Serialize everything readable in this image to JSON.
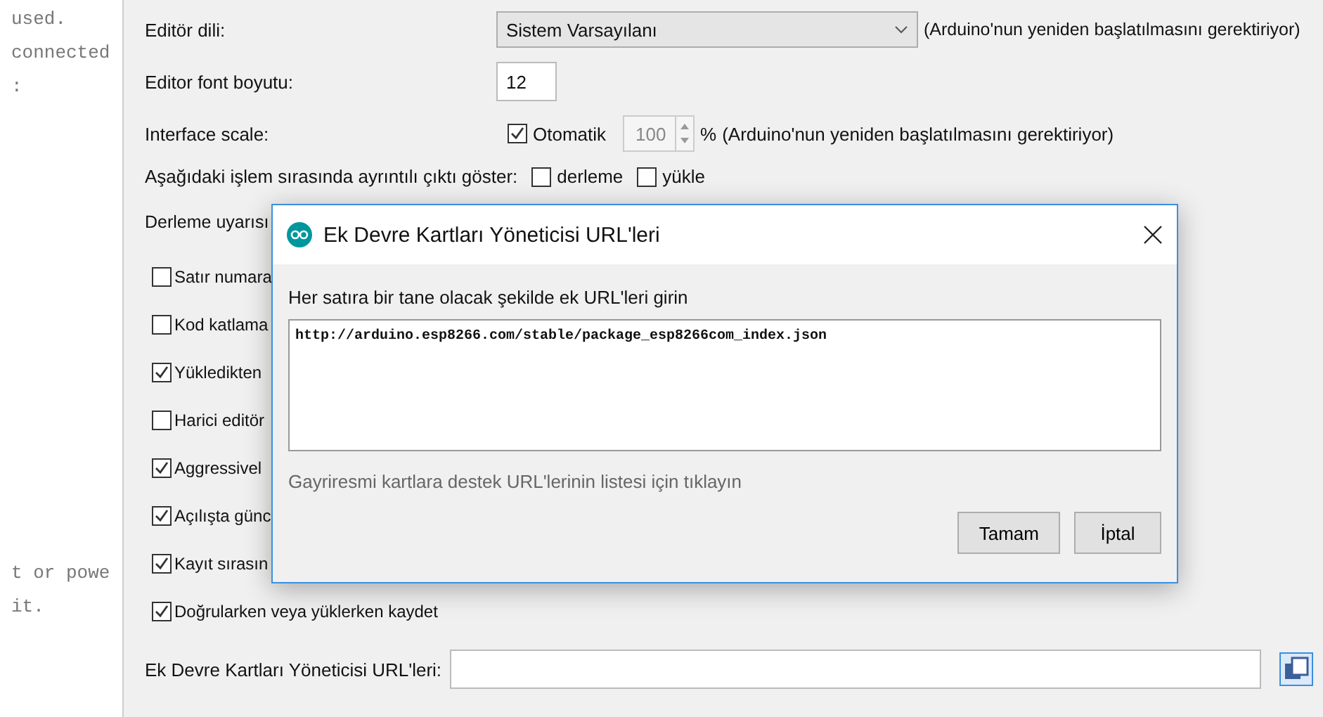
{
  "code_editor": {
    "top_lines": [
      "used.",
      "connected",
      ":"
    ],
    "bottom_lines": [
      "t or powe",
      "it."
    ]
  },
  "preferences": {
    "editor_language": {
      "label": "Editör dili:",
      "value": "Sistem Varsayılanı",
      "note": "(Arduino'nun yeniden başlatılmasını gerektiriyor)"
    },
    "font_size": {
      "label": "Editor font boyutu:",
      "value": "12"
    },
    "interface_scale": {
      "label": "Interface scale:",
      "auto_label": "Otomatik",
      "auto_checked": true,
      "value": "100",
      "unit": "%",
      "note": "(Arduino'nun yeniden başlatılmasını gerektiriyor)"
    },
    "verbose": {
      "label": "Aşağıdaki işlem sırasında ayrıntılı çıktı göster:",
      "options": [
        {
          "label": "derleme",
          "checked": false
        },
        {
          "label": "yükle",
          "checked": false
        }
      ]
    },
    "warnings": {
      "label": "Derleme uyarısı"
    },
    "checkboxes": [
      {
        "label": "Satır numara",
        "checked": false
      },
      {
        "label": "Kod katlama",
        "checked": false
      },
      {
        "label": "Yükledikten",
        "checked": true
      },
      {
        "label": "Harici editör",
        "checked": false
      },
      {
        "label": "Aggressivel",
        "checked": true
      },
      {
        "label": "Açılışta günc",
        "checked": true
      },
      {
        "label": "Kayıt sırasın",
        "checked": true
      },
      {
        "label": "Doğrularken veya yüklerken kaydet",
        "checked": true
      }
    ],
    "boards_url": {
      "label": "Ek Devre Kartları Yöneticisi URL'leri:"
    }
  },
  "dialog": {
    "title": "Ek Devre Kartları Yöneticisi URL'leri",
    "instruction": "Her satıra bir tane olacak şekilde ek URL'leri girin",
    "urls": "http://arduino.esp8266.com/stable/package_esp8266com_index.json",
    "link": "Gayriresmi kartlara destek URL'lerinin listesi için tıklayın",
    "buttons": [
      "Tamam",
      "İptal"
    ]
  }
}
